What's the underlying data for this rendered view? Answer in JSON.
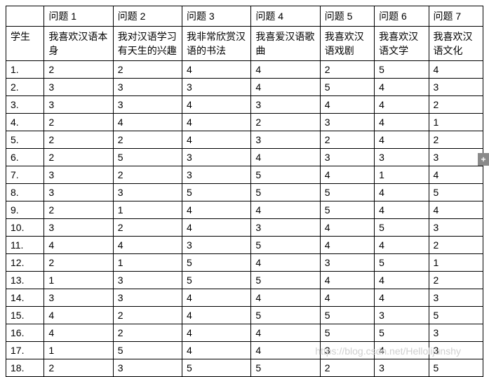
{
  "table": {
    "header_row1": [
      "",
      "问题 1",
      "问题 2",
      "问题 3",
      "问题 4",
      "问题 5",
      "问题 6",
      "问题 7"
    ],
    "header_row2": [
      "学生",
      "我喜欢汉语本身",
      "我对汉语学习有天生的兴趣",
      "我非常欣赏汉语的书法",
      "我喜爱汉语歌曲",
      "我喜欢汉语戏剧",
      "我喜欢汉语文学",
      "我喜欢汉语文化"
    ],
    "rows": [
      {
        "n": "1.",
        "v": [
          "2",
          "2",
          "4",
          "4",
          "2",
          "5",
          "4"
        ]
      },
      {
        "n": "2.",
        "v": [
          "3",
          "3",
          "3",
          "4",
          "5",
          "4",
          "3"
        ]
      },
      {
        "n": "3.",
        "v": [
          "3",
          "3",
          "4",
          "3",
          "4",
          "4",
          "2"
        ]
      },
      {
        "n": "4.",
        "v": [
          "2",
          "4",
          "4",
          "2",
          "3",
          "4",
          "1"
        ]
      },
      {
        "n": "5.",
        "v": [
          "2",
          "2",
          "4",
          "3",
          "2",
          "4",
          "2"
        ]
      },
      {
        "n": "6.",
        "v": [
          "2",
          "5",
          "3",
          "4",
          "3",
          "3",
          "3"
        ]
      },
      {
        "n": "7.",
        "v": [
          "3",
          "2",
          "3",
          "5",
          "4",
          "1",
          "4"
        ]
      },
      {
        "n": "8.",
        "v": [
          "3",
          "3",
          "5",
          "5",
          "5",
          "4",
          "5"
        ]
      },
      {
        "n": "9.",
        "v": [
          "2",
          "1",
          "4",
          "4",
          "5",
          "4",
          "4"
        ]
      },
      {
        "n": "10.",
        "v": [
          "3",
          "2",
          "4",
          "3",
          "4",
          "5",
          "3"
        ]
      },
      {
        "n": "11.",
        "v": [
          "4",
          "4",
          "3",
          "5",
          "4",
          "4",
          "2"
        ]
      },
      {
        "n": "12.",
        "v": [
          "2",
          "1",
          "5",
          "4",
          "3",
          "5",
          "1"
        ]
      },
      {
        "n": "13.",
        "v": [
          "1",
          "3",
          "5",
          "5",
          "4",
          "4",
          "2"
        ]
      },
      {
        "n": "14.",
        "v": [
          "3",
          "3",
          "4",
          "4",
          "4",
          "4",
          "3"
        ]
      },
      {
        "n": "15.",
        "v": [
          "4",
          "2",
          "4",
          "5",
          "5",
          "3",
          "5"
        ]
      },
      {
        "n": "16.",
        "v": [
          "4",
          "2",
          "4",
          "4",
          "5",
          "5",
          "3"
        ]
      },
      {
        "n": "17.",
        "v": [
          "1",
          "5",
          "4",
          "4",
          "3",
          "4",
          "3"
        ]
      },
      {
        "n": "18.",
        "v": [
          "2",
          "3",
          "5",
          "5",
          "2",
          "3",
          "5"
        ]
      }
    ]
  },
  "watermark": "https://blog.csdn.net/Hellolijunshy",
  "badge": "+"
}
